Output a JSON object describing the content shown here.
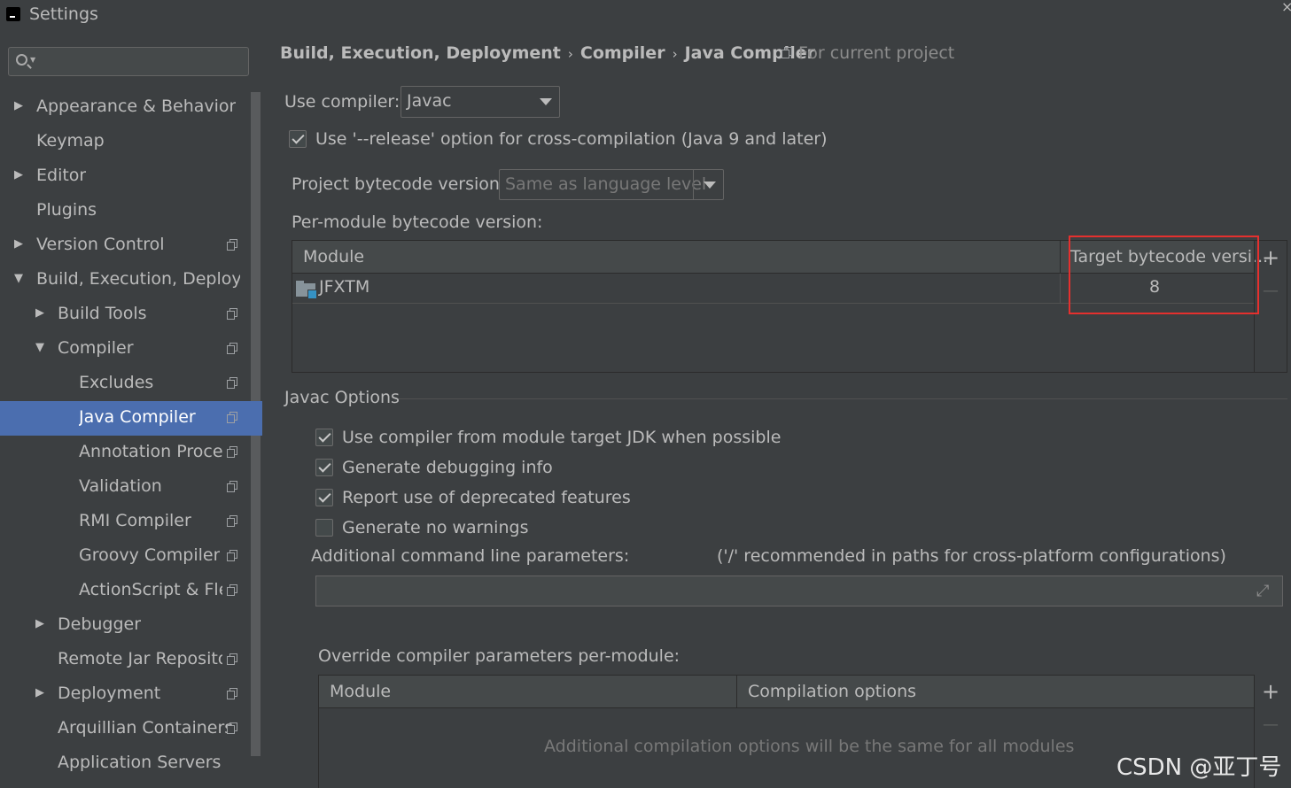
{
  "window": {
    "title": "Settings",
    "close_glyph": "×"
  },
  "search": {
    "placeholder": "",
    "icon": "search-icon"
  },
  "sidebar": {
    "items": [
      {
        "label": "Appearance & Behavior",
        "arrow": "▶",
        "bold": true
      },
      {
        "label": "Keymap",
        "arrow": "",
        "bold": true
      },
      {
        "label": "Editor",
        "arrow": "▶",
        "bold": true
      },
      {
        "label": "Plugins",
        "arrow": "",
        "bold": true
      },
      {
        "label": "Version Control",
        "arrow": "▶",
        "bold": true,
        "project_icon": true
      },
      {
        "label": "Build, Execution, Deploym",
        "arrow": "▼",
        "bold": true
      },
      {
        "label": "Build Tools",
        "arrow": "▶",
        "project_icon": true
      },
      {
        "label": "Compiler",
        "arrow": "▼",
        "project_icon": true
      },
      {
        "label": "Excludes",
        "project_icon": true
      },
      {
        "label": "Java Compiler",
        "project_icon": true,
        "selected": true
      },
      {
        "label": "Annotation Processo",
        "project_icon": true
      },
      {
        "label": "Validation",
        "project_icon": true
      },
      {
        "label": "RMI Compiler",
        "project_icon": true
      },
      {
        "label": "Groovy Compiler",
        "project_icon": true
      },
      {
        "label": "ActionScript & Flex",
        "project_icon": true
      },
      {
        "label": "Debugger",
        "arrow": "▶"
      },
      {
        "label": "Remote Jar Repositori",
        "project_icon": true
      },
      {
        "label": "Deployment",
        "arrow": "▶",
        "project_icon": true
      },
      {
        "label": "Arquillian Containers",
        "project_icon": true
      },
      {
        "label": "Application Servers"
      }
    ]
  },
  "breadcrumb": {
    "parts": [
      "Build, Execution, Deployment",
      "Compiler",
      "Java Compiler"
    ],
    "separator": "›",
    "scope_label": "For current project"
  },
  "compiler": {
    "use_compiler_label": "Use compiler:",
    "use_compiler_value": "Javac",
    "release_option_label": "Use '--release' option for cross-compilation (Java 9 and later)",
    "release_option_checked": true,
    "project_bytecode_label": "Project bytecode version:",
    "project_bytecode_value": "Same as language level",
    "per_module_label": "Per-module bytecode version:"
  },
  "module_table": {
    "headers": [
      "Module",
      "Target bytecode versi..."
    ],
    "rows": [
      {
        "module": "JFXTM",
        "target": "8"
      }
    ],
    "add_glyph": "+",
    "remove_glyph": "—"
  },
  "javac_options": {
    "section_title": "Javac Options",
    "checkboxes": [
      {
        "label": "Use compiler from module target JDK when possible",
        "checked": true
      },
      {
        "label": "Generate debugging info",
        "checked": true
      },
      {
        "label": "Report use of deprecated features",
        "checked": true
      },
      {
        "label": "Generate no warnings",
        "checked": false
      }
    ],
    "additional_params_label": "Additional command line parameters:",
    "additional_params_hint": "('/' recommended in paths for cross-platform configurations)",
    "additional_params_value": "",
    "expand_glyph": "⤢"
  },
  "override_table": {
    "title": "Override compiler parameters per-module:",
    "headers": [
      "Module",
      "Compilation options"
    ],
    "empty_text": "Additional compilation options will be the same for all modules",
    "add_glyph": "+",
    "remove_glyph": "—"
  },
  "watermark": "CSDN @亚丁号",
  "colors": {
    "background": "#3c3f41",
    "selection": "#4b6eaf",
    "highlight_box": "#e5302e",
    "module_badge": "#3592c4"
  }
}
